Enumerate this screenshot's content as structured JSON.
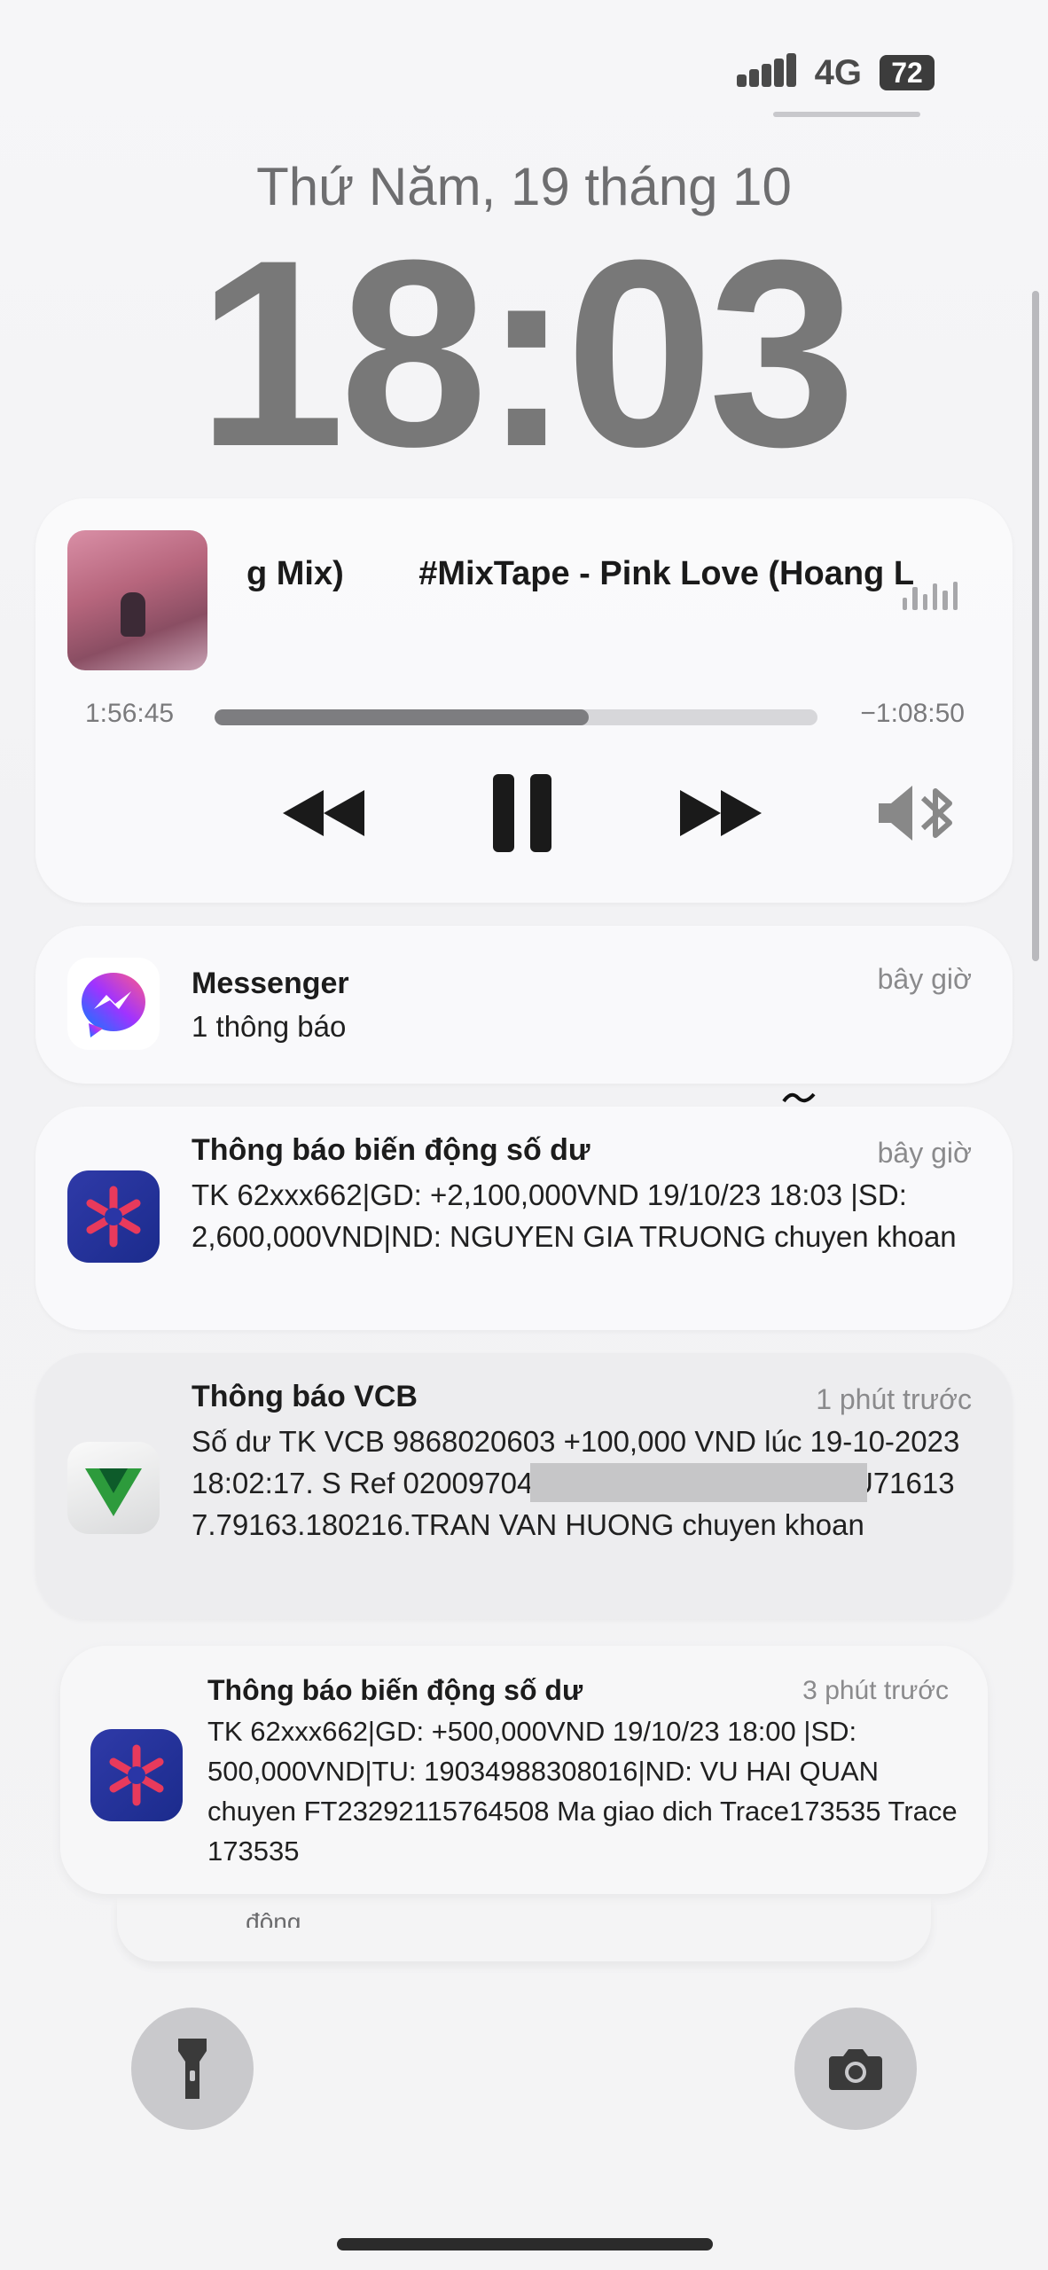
{
  "status_bar": {
    "network": "4G",
    "battery": "72"
  },
  "lock_screen": {
    "date": "Thứ Năm, 19 tháng 10",
    "time": "18:03"
  },
  "now_playing": {
    "title_scrolling": "g Mix)        #MixTape - Pink Love (Hoang L",
    "elapsed": "1:56:45",
    "remaining": "−1:08:50",
    "progress_fraction": 0.62,
    "icons": [
      "rewind-icon",
      "pause-icon",
      "fast-forward-icon",
      "bluetooth-speaker-icon",
      "audio-level-icon"
    ]
  },
  "notifications": [
    {
      "app": "Messenger",
      "title": "Messenger",
      "time": "bây giờ",
      "body": "1 thông báo"
    },
    {
      "app": "Bank",
      "title": "Thông báo biến động số dư",
      "time": "bây giờ",
      "body": "TK 62xxx662|GD: +2,100,000VND 19/10/23 18:03 |SD: 2,600,000VND|ND: NGUYEN GIA TRUONG chuyen khoan"
    },
    {
      "app": "VCB",
      "title": "Thông báo VCB",
      "time": "1 phút trước",
      "body": "Số dư TK VCB 9868020603 +100,000 VND lúc 19-10-2023 18:02:17. S                                            Ref 0200970422101918021520 23XOIU716137.79163.180216.TRAN VAN HUONG chuyen khoan"
    },
    {
      "app": "Bank",
      "title": "Thông báo biến động số dư",
      "time": "3 phút trước",
      "body": "TK 62xxx662|GD: +500,000VND 19/10/23 18:00 |SD: 500,000VND|TU: 19034988308016|ND: VU HAI QUAN chuyen FT23292115764508   Ma giao dich Trace173535 Trace 173535"
    }
  ],
  "stacked_hint": "... động",
  "bottom": {
    "left_button": "flashlight-icon",
    "right_button": "camera-icon"
  }
}
